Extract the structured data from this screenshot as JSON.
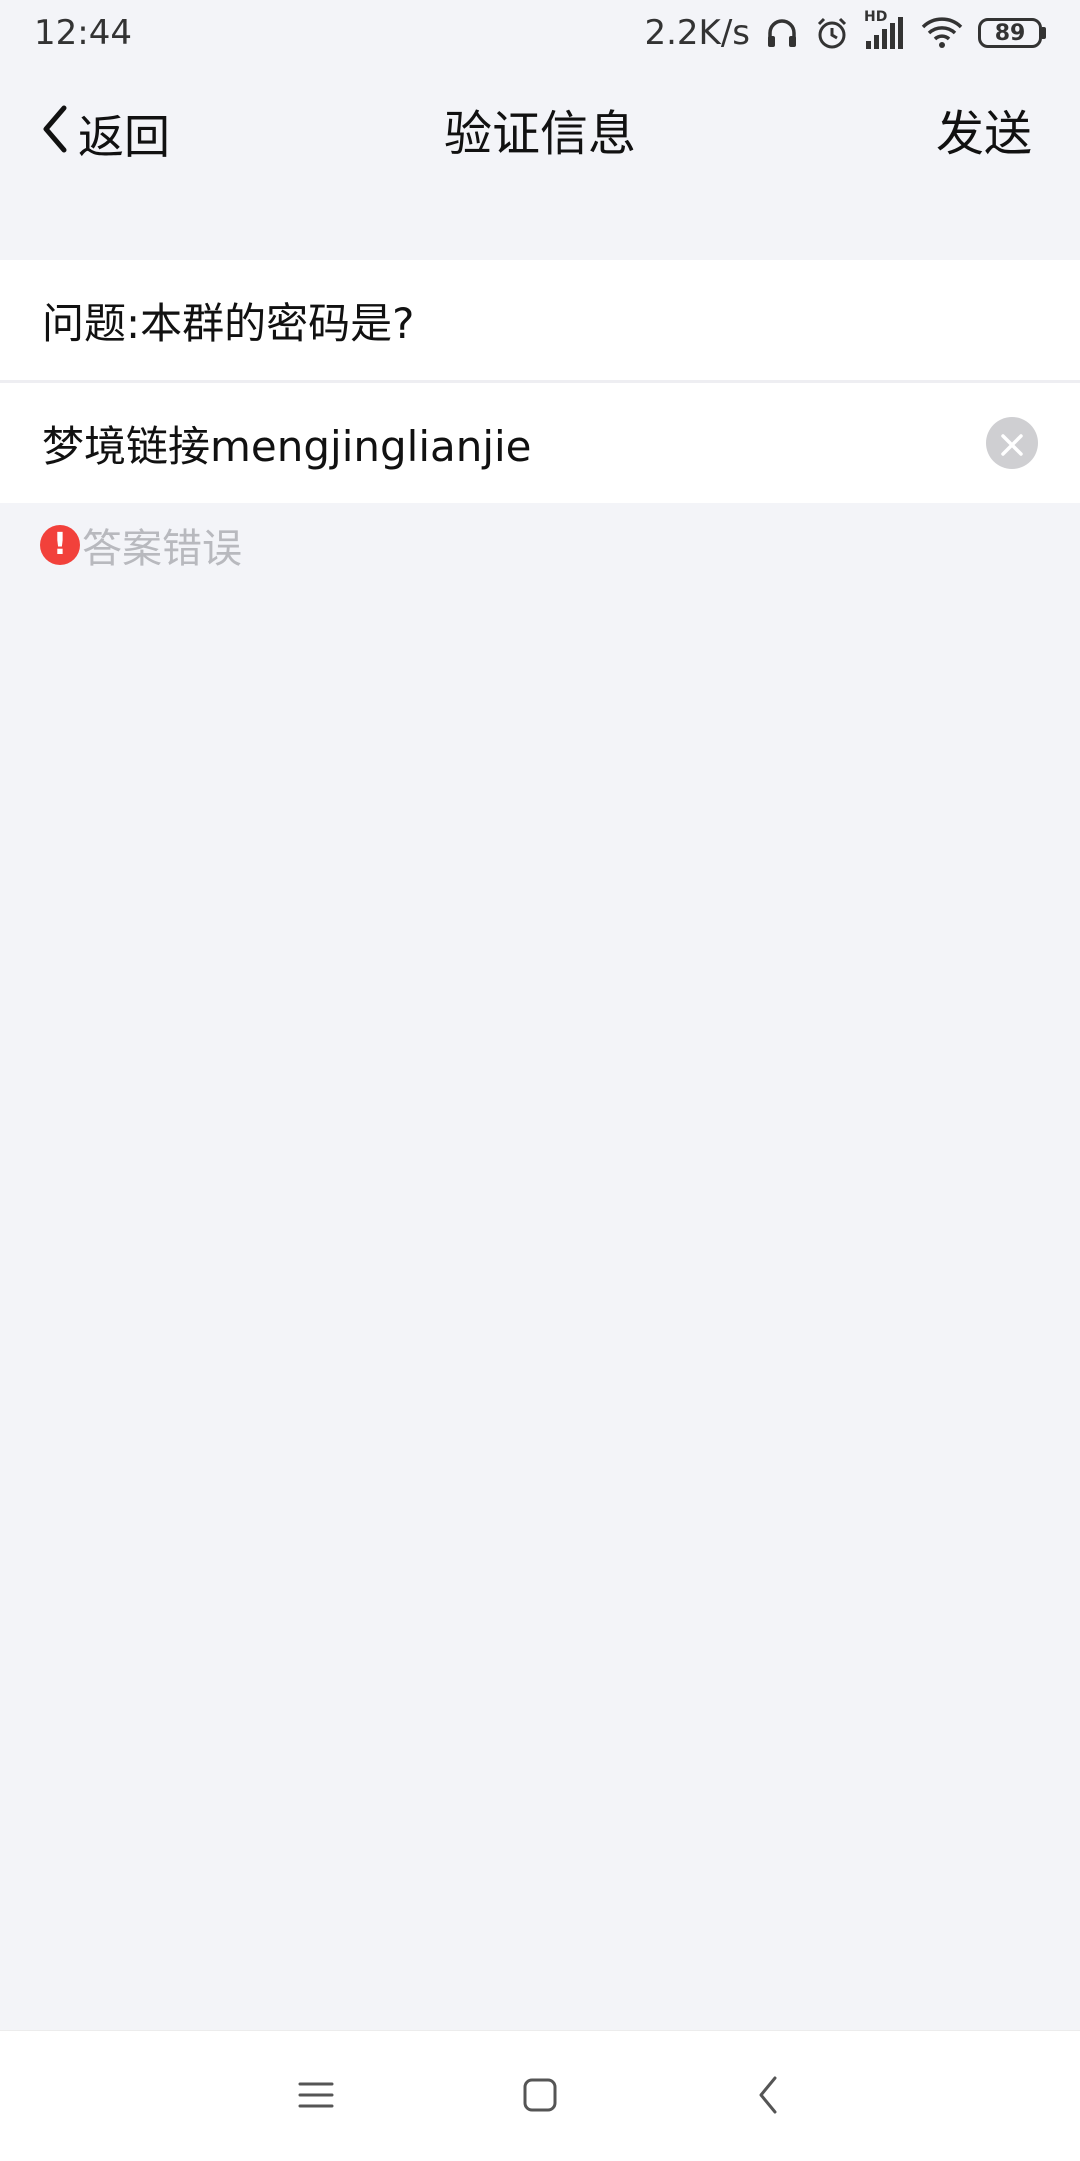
{
  "status_bar": {
    "time": "12:44",
    "network_speed": "2.2K/s",
    "signal_label": "HD",
    "battery_level": "89",
    "icons": [
      "headphones-icon",
      "alarm-icon",
      "signal-icon",
      "wifi-icon",
      "battery-icon"
    ]
  },
  "header": {
    "back_label": "返回",
    "title": "验证信息",
    "send_label": "发送"
  },
  "form": {
    "question": "问题:本群的密码是?",
    "answer_value": "梦境链接mengjinglianjie",
    "error_message": "答案错误"
  },
  "nav": {
    "buttons": [
      "menu-icon",
      "home-icon",
      "back-icon"
    ]
  },
  "colors": {
    "background": "#f3f4f8",
    "error_red": "#f2413b",
    "hint_gray": "#b8b9be"
  }
}
